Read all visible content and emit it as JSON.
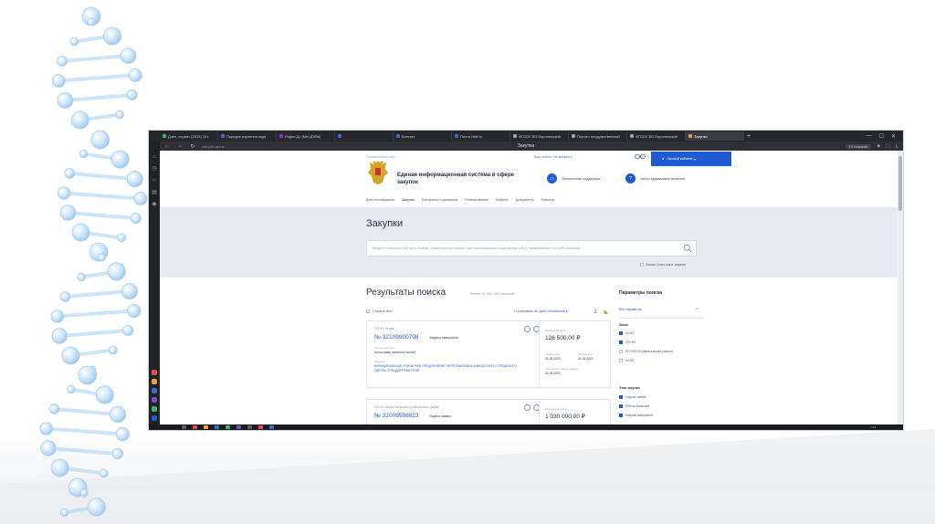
{
  "browser": {
    "tabs": [
      {
        "label": "Дзен. сервис (2019) 15×",
        "color": "#3cb371"
      },
      {
        "label": "Порядок изучения кода",
        "color": "#6a5acd"
      },
      {
        "label": "Радио Дз (Мн) [DRM]",
        "color": "#8a2be2"
      },
      {
        "label": "",
        "color": "#4169e1"
      },
      {
        "label": "Контакт",
        "color": "#3a6ec2"
      },
      {
        "label": "Почта Mail.ru",
        "color": "#3a6ec2"
      },
      {
        "label": "ФГБОУ ВО Воронежский",
        "color": "#9aa3b2"
      },
      {
        "label": "Портал государственный",
        "color": "#9aa3b2"
      },
      {
        "label": "ФГБОУ ВО Воронежский",
        "color": "#9aa3b2"
      },
      {
        "label": "Закупки",
        "color": "#e1a23c",
        "active": true
      }
    ],
    "url": "zakupki.gov.ru",
    "page_title": "Закупки",
    "speed": "13 отзывов",
    "clock": "1:14"
  },
  "header": {
    "official": "Официальный сайт",
    "region_label": "Ваш регион:",
    "region_value": "Не выбран",
    "cabinet_button": "Личный кабинет",
    "site_name": "Единая информационная система в сфере закупок",
    "support_link": "Техническая поддержка",
    "faq_link": "Часто задаваемые вопросы"
  },
  "nav": {
    "items": [
      "Для поставщиков",
      "Закупки",
      "Контракты и договоры",
      "Планирование",
      "Каталог",
      "Документы",
      "Новости"
    ]
  },
  "search": {
    "title": "Закупки",
    "placeholder": "Введите полностью или часть номера, наименование закупки, идентификационного кода закупки (ИКЗ), наименование или ИНН Заказчика",
    "exact_label": "Искать точно как в запросе"
  },
  "results": {
    "title": "Результаты поиска",
    "count": "более 30 000 000 записей",
    "expand_label": "Открыть теги",
    "sort_label": "Сортировать по:",
    "sort_value": "Дате обновления",
    "cards": [
      {
        "law": "223-ФЗ Тендер",
        "number": "№ 32109900798",
        "stage": "Закупка завершена",
        "object_label": "Объект закупки",
        "object": "на поставку запасных частей",
        "customer_label": "Заказчик",
        "customer": "МУНИЦИПАЛЬНОЕ УНИТАРНОЕ ПРЕДПРИЯТИЕ ПЕТРОПАВЛОВСК-КАМЧАТСКОГО ГОРОДСКОГО ОКРУГА 'СПЕЦДОРРЕМСТРОЙ'",
        "price_label": "Начальная цена",
        "price": "126 500,00 ₽",
        "date1_label": "Размещено",
        "date1": "31.05.2023",
        "date2_label": "Обновлено",
        "date2": "31.05.2023",
        "date3_label": "Окончание подачи заявок",
        "date3": "31.05.2023"
      },
      {
        "law": "223-ФЗ Запрос котировок в электронной форме",
        "number": "№ 32009598823",
        "stage": "Подача заявок",
        "price_label": "Начальная цена",
        "price": "1 030 000,00 ₽"
      }
    ]
  },
  "params": {
    "title": "Параметры поиска",
    "all_link": "Все параметры",
    "law_group": "Закон",
    "laws": [
      {
        "label": "44-ФЗ",
        "checked": true
      },
      {
        "label": "223-ФЗ",
        "checked": true
      },
      {
        "label": "ПП РФ 615 (Капитальный ремонт)",
        "checked": false
      },
      {
        "label": "94-ФЗ",
        "checked": false
      }
    ],
    "stage_group": "Этап закупки",
    "stages": [
      {
        "label": "Подача заявок",
        "checked": true
      },
      {
        "label": "Работа комиссии",
        "checked": true
      },
      {
        "label": "Закупка завершена",
        "checked": true
      }
    ]
  },
  "colors": {
    "accent": "#1f5bd4",
    "band": "#e7eaf0",
    "dna": "#9cc8ee"
  }
}
